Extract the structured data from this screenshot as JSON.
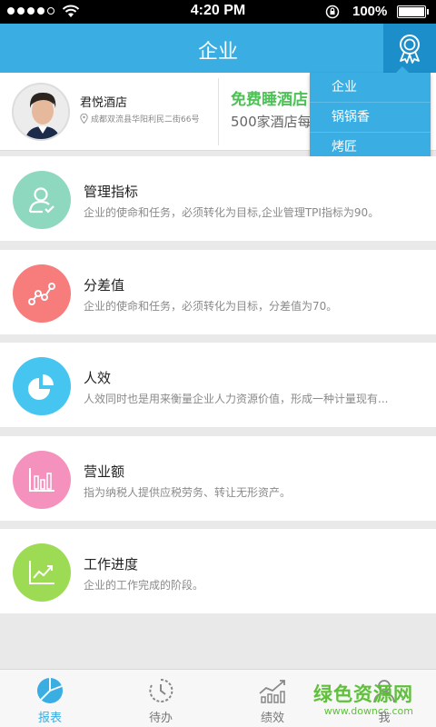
{
  "status_bar": {
    "time": "4:20 PM",
    "battery": "100%"
  },
  "header": {
    "title": "企业"
  },
  "profile": {
    "hotel_name": "君悦酒店",
    "address": "成都双流县华阳利民二街66号",
    "promo_title": "免费睡酒店",
    "promo_subtitle": "500家酒店每"
  },
  "dropdown": {
    "items": [
      "企业",
      "锅锅香",
      "烤匠"
    ]
  },
  "list": [
    {
      "title": "管理指标",
      "desc": "企业的使命和任务，必须转化为目标,企业管理TPI指标为90。",
      "icon": "person-check-icon",
      "color": "#8fd8c0"
    },
    {
      "title": "分差值",
      "desc": "企业的使命和任务，必须转化为目标，分差值为70。",
      "icon": "line-graph-icon",
      "color": "#f77c7c"
    },
    {
      "title": "人效",
      "desc": "人效同时也是用来衡量企业人力资源价值，形成一种计量现有...",
      "icon": "pie-chart-icon",
      "color": "#45c5f0"
    },
    {
      "title": "营业额",
      "desc": "指为纳税人提供应税劳务、转让无形资产。",
      "icon": "bar-chart-icon",
      "color": "#f591bd"
    },
    {
      "title": "工作进度",
      "desc": "企业的工作完成的阶段。",
      "icon": "trend-chart-icon",
      "color": "#9ddb55"
    }
  ],
  "tabbar": {
    "items": [
      "报表",
      "待办",
      "绩效",
      "我"
    ]
  },
  "watermark": {
    "text": "绿色资源网",
    "url": "www.downcc.com"
  }
}
